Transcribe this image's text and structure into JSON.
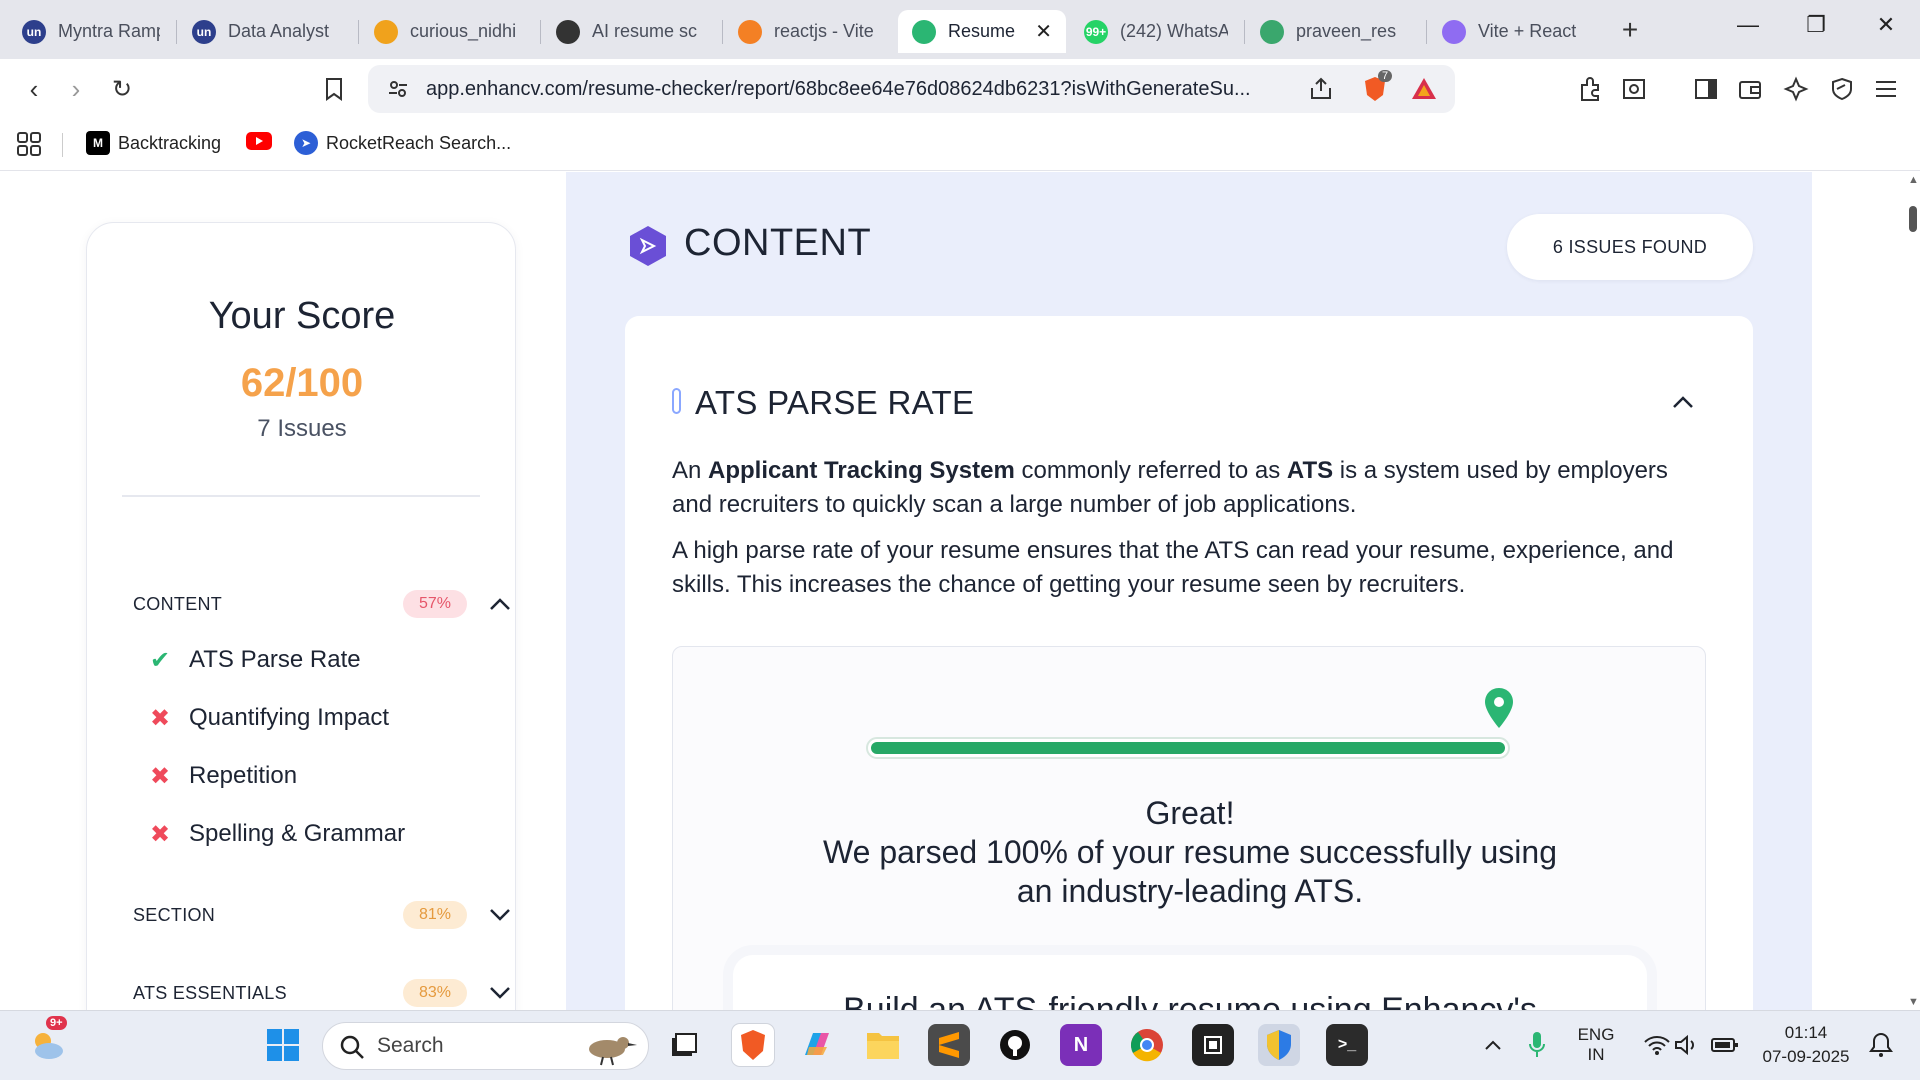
{
  "browser": {
    "tabs": [
      {
        "title": "Myntra Ramp",
        "favicon": "un",
        "color": "#2d3f8c"
      },
      {
        "title": "Data Analyst",
        "favicon": "un",
        "color": "#2d3f8c"
      },
      {
        "title": "curious_nidhi",
        "favicon": "leetcode-icon",
        "color": "#f0a21c"
      },
      {
        "title": "AI resume sc",
        "favicon": "openai-icon",
        "color": "#333333"
      },
      {
        "title": "reactjs - Vite",
        "favicon": "stackoverflow-icon",
        "color": "#f48024"
      },
      {
        "title": "Resume",
        "favicon": "enhancv-icon",
        "color": "#2bb673",
        "active": true
      },
      {
        "title": "(242) WhatsA",
        "favicon": "99+",
        "color": "#25d366"
      },
      {
        "title": "praveen_res",
        "favicon": "resume-icon",
        "color": "#3aa76d"
      },
      {
        "title": "Vite + React",
        "favicon": "vite-icon",
        "color": "#8f6cf2"
      }
    ],
    "new_tab": "+",
    "url": "app.enhancv.com/resume-checker/report/68bc8ee64e76d08624db6231?isWithGenerateSu...",
    "brave_badge": "7",
    "bookmarks": [
      {
        "label": "",
        "icon": "apps-grid-icon"
      },
      {
        "label": "Backtracking",
        "icon": "medium-icon",
        "icon_text": "M"
      },
      {
        "label": "",
        "icon": "youtube-icon"
      },
      {
        "label": "RocketReach Search...",
        "icon": "rocket-icon"
      }
    ]
  },
  "score": {
    "title": "Your Score",
    "value": "62/100",
    "issues": "7 Issues",
    "categories": [
      {
        "label": "CONTENT",
        "percent": "57%",
        "expanded": true,
        "badge_color": "red",
        "items": [
          {
            "label": "ATS Parse Rate",
            "status": "pass"
          },
          {
            "label": "Quantifying Impact",
            "status": "fail"
          },
          {
            "label": "Repetition",
            "status": "fail"
          },
          {
            "label": "Spelling & Grammar",
            "status": "fail"
          }
        ]
      },
      {
        "label": "SECTION",
        "percent": "81%",
        "expanded": false,
        "badge_color": "orange"
      },
      {
        "label": "ATS ESSENTIALS",
        "percent": "83%",
        "expanded": false,
        "badge_color": "orange"
      }
    ],
    "pass_mark": "✔",
    "fail_mark": "✖"
  },
  "content": {
    "title": "CONTENT",
    "issues_found": "6 ISSUES FOUND",
    "section": {
      "title": "ATS PARSE RATE",
      "para1": {
        "pre": "An ",
        "b1": "Applicant Tracking System",
        "mid": " commonly referred to as ",
        "b2": "ATS",
        "post": " is a system used by employers and recruiters to quickly scan a large number of job applications."
      },
      "para2": "A high parse rate of your resume ensures that the ATS can read your resume, experience, and skills. This increases the chance of getting your resume seen by recruiters.",
      "parse_percent": 100,
      "result_line1": "Great!",
      "result_line2": "We parsed 100% of your resume successfully using",
      "result_line3": "an industry-leading ATS.",
      "promo": "Build an ATS-friendly resume using Enhancv's"
    }
  },
  "taskbar": {
    "weather_badge": "9+",
    "search_placeholder": "Search",
    "lang_line1": "ENG",
    "lang_line2": "IN",
    "time": "01:14",
    "date": "07-09-2025"
  },
  "colors": {
    "score": "#f5a24b",
    "pass": "#2bb673",
    "fail": "#ef4a5b",
    "progress": "#26a866",
    "panel_bg": "#eaeefb"
  }
}
